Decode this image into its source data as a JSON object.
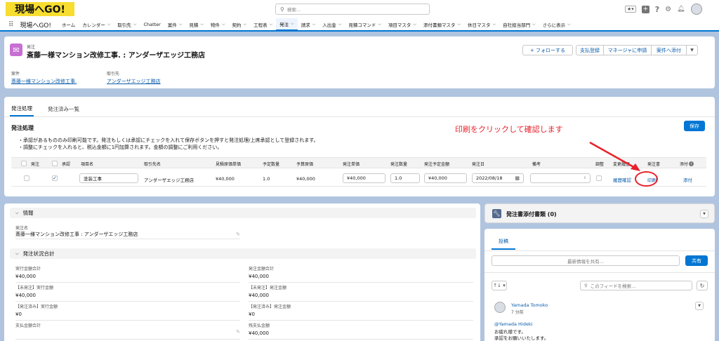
{
  "app": {
    "logo": "現場へGO!",
    "name": "現場へGO!"
  },
  "search": {
    "placeholder": "検索..."
  },
  "nav": [
    "ホーム",
    "カレンダー",
    "取引先",
    "Chatter",
    "案件",
    "見積",
    "物件",
    "契約",
    "工程表",
    "発注",
    "請求",
    "入出金",
    "見積コマンド",
    "項目マスタ",
    "添付書類マスタ",
    "休日マスタ",
    "自社担当部門",
    "さらに表示"
  ],
  "nav_dropdown": [
    false,
    true,
    true,
    false,
    true,
    true,
    true,
    true,
    true,
    true,
    true,
    true,
    true,
    true,
    true,
    true,
    true,
    true
  ],
  "nav_active": "発注",
  "record": {
    "object_label": "発注",
    "title": "斎藤一様マンション改修工事. : アンダーザエッジ工務店",
    "follow": "+ フォローする",
    "actions": [
      "支払登録",
      "マネージャに申請",
      "案件へ添付"
    ],
    "fields": [
      {
        "label": "案件",
        "value": "斎藤一様マンション改修工事."
      },
      {
        "label": "取引先",
        "value": "アンダーザエッジ工務店"
      }
    ]
  },
  "tabs": [
    "発注処理",
    "発注済み一覧"
  ],
  "order": {
    "heading": "発注処理",
    "save": "保存",
    "notes": [
      "・承認があるもののみ印刷可能です。発注もしくは承認にチェックを入れて保存ボタンを押すと発注処理/上席承認として登録されます。",
      "・調整にチェックを入れると、税込金額に1円加算されます。金額の調整にご利用ください。"
    ],
    "annotation": "印刷をクリックして確認します",
    "columns": [
      "発注",
      "承認",
      "項目名",
      "取引先名",
      "見積原価単価",
      "予定数量",
      "予算原価",
      "発注単価",
      "発注数量",
      "発注予定金額",
      "発注日",
      "備考",
      "調整",
      "変更履歴",
      "発注書",
      "添付"
    ],
    "row": {
      "item": "塗装工事",
      "vendor": "アンダーザエッジ工務店",
      "est_unit": "¥40,000",
      "qty": "1.0",
      "budget": "¥40,000",
      "unit_price": "¥40,000",
      "order_qty": "1.0",
      "order_amount": "¥40,000",
      "date": "2022/08/18",
      "history": "履歴確認",
      "print": "印刷",
      "attach": "添付"
    }
  },
  "info": {
    "section1": "情報",
    "name_label": "発注名",
    "name_value": "斎藤一様マンション改修工事 : アンダーザエッジ工務店",
    "section2": "発注状況合計",
    "left": [
      {
        "label": "実行金額合計",
        "value": "¥40,000"
      },
      {
        "label": "【未発注】実行金額",
        "value": "¥40,000"
      },
      {
        "label": "【発注済み】実行金額",
        "value": "¥0"
      },
      {
        "label": "支払金額合計",
        "value": ""
      }
    ],
    "right": [
      {
        "label": "発注金額合計",
        "value": "¥40,000"
      },
      {
        "label": "【未発注】発注金額",
        "value": "¥40,000"
      },
      {
        "label": "【発注済み】発注金額",
        "value": "¥0"
      },
      {
        "label": "残支払金額",
        "value": "¥40,000"
      }
    ]
  },
  "side": {
    "attach_title": "発注書添付書類 (0)",
    "feed_tab": "投稿",
    "share_placeholder": "最新情報を共有...",
    "share_btn": "共有",
    "sort": "↑↓ ▾",
    "feed_search": "このフィードを検索...",
    "post": {
      "author": "Yamada Tomoko",
      "time": "7 分前",
      "mention": "@Yamada Hideki",
      "line1": "お疲れ様です。",
      "line2": "承認をお願いいたします。"
    }
  },
  "colors": {
    "brand": "#0176d3",
    "annotation": "#e8212b",
    "logo_bg": "#f7dd2f"
  }
}
